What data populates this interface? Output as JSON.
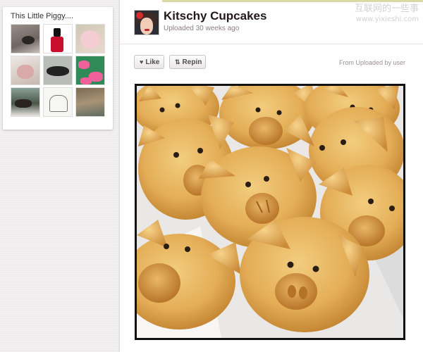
{
  "board": {
    "title": "This Little Piggy....",
    "thumbnails": [
      "pig-thumb-1",
      "nail-polish-thumb",
      "piglet-thumb",
      "piglet-blanket-thumb",
      "black-pig-thumb",
      "pink-pig-pattern-thumb",
      "pig-photo-thumb",
      "pig-sketch-thumb",
      "pig-painting-thumb"
    ]
  },
  "pin": {
    "title": "Kitschy Cupcakes",
    "uploaded": "Uploaded 30 weeks ago",
    "like_label": "Like",
    "repin_label": "Repin",
    "source": "From Uploaded by user"
  },
  "watermark": {
    "text": "互联网的一些事",
    "url": "www.yixieshi.com"
  },
  "colors": {
    "background": "#efecec",
    "bread": "#e7b560",
    "bread_dark": "#c88a33",
    "border": "#111111"
  }
}
